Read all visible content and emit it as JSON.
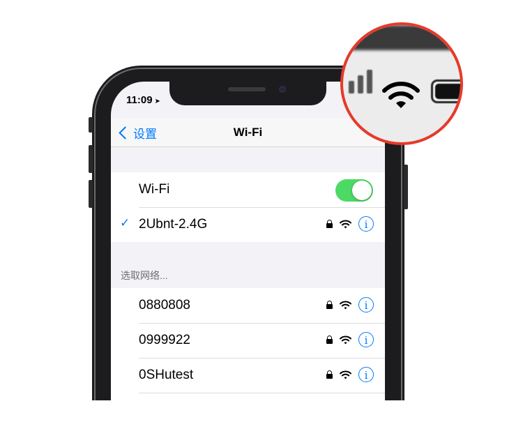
{
  "status_bar": {
    "time": "11:09",
    "location_icon": "location-arrow-icon"
  },
  "nav": {
    "back_label": "设置",
    "title": "Wi-Fi"
  },
  "wifi_toggle": {
    "label": "Wi-Fi",
    "on": true,
    "on_color": "#4cd964"
  },
  "connected_network": {
    "name": "2Ubnt-2.4G",
    "checkmark": "✓",
    "secured": true
  },
  "section_header": "选取网络...",
  "networks": [
    {
      "name": "0880808",
      "secured": true
    },
    {
      "name": "0999922",
      "secured": true
    },
    {
      "name": "0SHutest",
      "secured": true
    }
  ],
  "info_glyph": "i",
  "colors": {
    "accent": "#007aff",
    "magnifier_ring": "#e63a2a",
    "toggle_on": "#4cd964"
  }
}
